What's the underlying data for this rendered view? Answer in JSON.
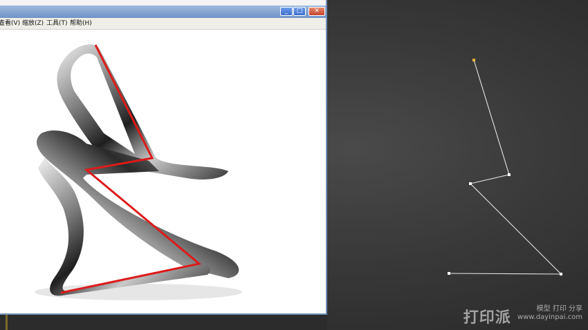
{
  "viewer": {
    "window_buttons": {
      "minimize": "_",
      "maximize": "□",
      "close": "✕"
    },
    "menu": [
      "查看(V)",
      "缩放(Z)",
      "工具(T)",
      "帮助(H)"
    ]
  },
  "spline": {
    "vertex_color": "#ffffff",
    "selected_vertex_color": "#e8b43a",
    "line_color": "#e6e6e6"
  },
  "reference_overlay_color": "#dd1a1a",
  "watermark": {
    "brand": "打印派",
    "subtitle": "模型 打印 分享",
    "url": "www.dayinpai.com"
  }
}
